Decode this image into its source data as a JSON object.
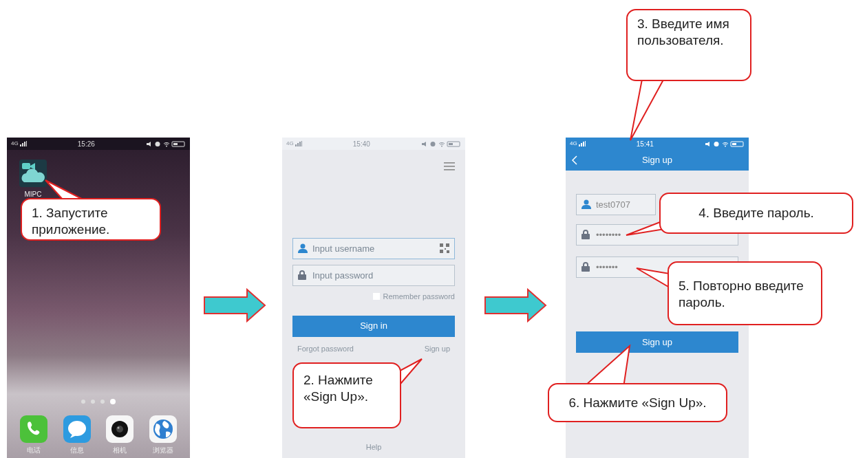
{
  "phones": [
    {
      "kind": "home",
      "status": {
        "network": "4G",
        "time": "15:26"
      },
      "apps": [
        {
          "label": "MIPC"
        }
      ],
      "page_dots": [
        {
          "selected": false
        },
        {
          "selected": false
        },
        {
          "selected": false
        },
        {
          "selected": true
        }
      ],
      "dock": [
        {
          "kind": "phone",
          "label": "电话"
        },
        {
          "kind": "messages",
          "label": "信息"
        },
        {
          "kind": "camera",
          "label": "相机"
        },
        {
          "kind": "browser",
          "label": "浏览器"
        }
      ]
    },
    {
      "kind": "login",
      "status": {
        "network": "4G",
        "time": "15:40"
      },
      "username": {
        "placeholder": "Input username"
      },
      "password": {
        "placeholder": "Input password"
      },
      "remember": {
        "label": "Remember password",
        "checked": false
      },
      "sign_in": "Sign in",
      "forgot": "Forgot password",
      "sign_up": "Sign up",
      "help": "Help"
    },
    {
      "kind": "signup",
      "status": {
        "network": "4G",
        "time": "15:41"
      },
      "title": "Sign up",
      "username": "test0707",
      "password": "••••••••",
      "confirm": "•••••••",
      "button": "Sign up"
    }
  ],
  "callouts": [
    {
      "text": "1. Запустите приложение."
    },
    {
      "text": "2. Нажмите «Sign Up»."
    },
    {
      "text": "3. Введите имя пользователя."
    },
    {
      "text": "4. Введите пароль."
    },
    {
      "text": "5. Повторно введите пароль."
    },
    {
      "text": "6. Нажмите «Sign Up»."
    }
  ]
}
